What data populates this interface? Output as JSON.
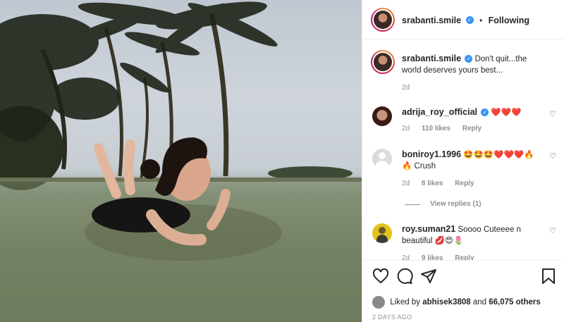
{
  "post": {
    "username": "srabanti.smile",
    "verified_mark": "✓",
    "separator": "•",
    "follow_status": "Following"
  },
  "caption": {
    "username": "srabanti.smile",
    "text": "Don't quit...the world deserves yours best...",
    "time": "2d"
  },
  "comments": [
    {
      "username": "adrija_roy_official",
      "text": "❤️❤️❤️",
      "time": "2d",
      "likes": "110 likes",
      "reply": "Reply"
    },
    {
      "username": "boniroy1.1996",
      "text": "🤩🤩🤩❤️❤️❤️🔥 🔥 Crush",
      "time": "2d",
      "likes": "8 likes",
      "reply": "Reply"
    },
    {
      "username": "roy.suman21",
      "text": "Soooo Cuteeee n beautiful 💋😍🌷",
      "time": "2d",
      "likes": "9 likes",
      "reply": "Reply"
    }
  ],
  "view_replies": "View replies (1)",
  "likes": {
    "prefix": "Liked by",
    "user": "abhisek3808",
    "conj": "and",
    "count": "66,075 others"
  },
  "posted_ago": "2 DAYS AGO",
  "icons": {
    "like": "heart-icon",
    "comment": "comment-icon",
    "share": "share-icon",
    "save": "bookmark-icon"
  },
  "colors": {
    "verified": "#3897f0",
    "heart_red": "#ed4956"
  }
}
